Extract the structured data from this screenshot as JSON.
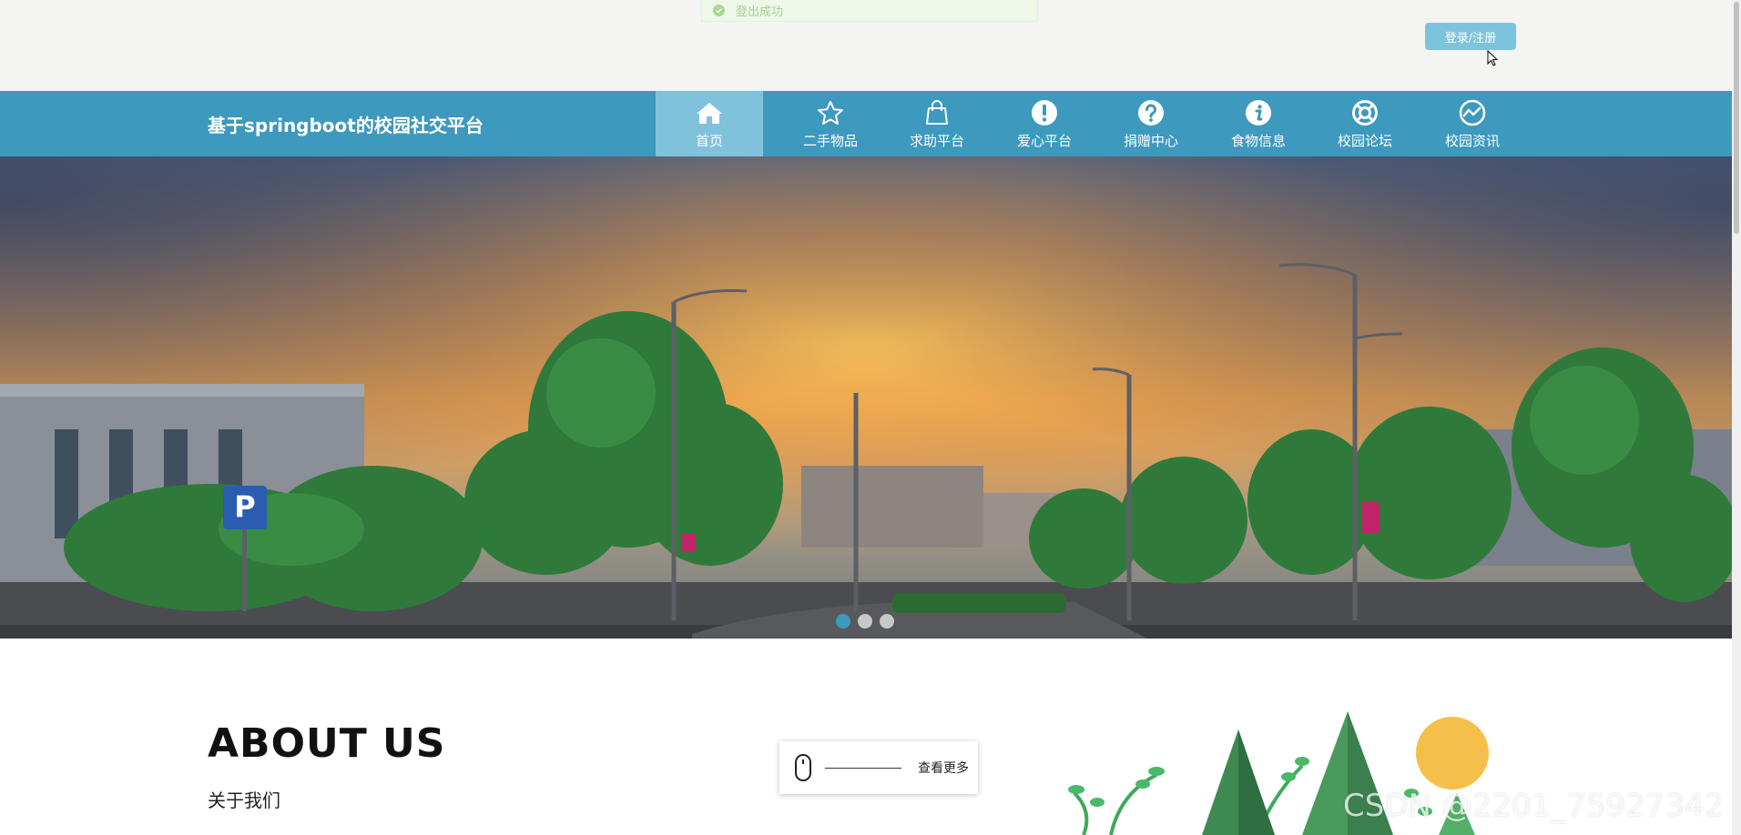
{
  "toast": {
    "message": "登出成功"
  },
  "header": {
    "login_label": "登录/注册"
  },
  "navbar": {
    "brand": "基于springboot的校园社交平台",
    "items": [
      {
        "label": "首页",
        "icon": "home-icon",
        "active": true
      },
      {
        "label": "二手物品",
        "icon": "star-icon",
        "active": false
      },
      {
        "label": "求助平台",
        "icon": "shopping-bag-icon",
        "active": false
      },
      {
        "label": "爱心平台",
        "icon": "exclamation-icon",
        "active": false
      },
      {
        "label": "捐赠中心",
        "icon": "question-icon",
        "active": false
      },
      {
        "label": "食物信息",
        "icon": "info-icon",
        "active": false
      },
      {
        "label": "校园论坛",
        "icon": "lifebuoy-icon",
        "active": false
      },
      {
        "label": "校园资讯",
        "icon": "trend-icon",
        "active": false
      }
    ]
  },
  "carousel": {
    "slide_count": 3,
    "active_index": 0
  },
  "about": {
    "title": "ABOUT US",
    "subtitle": "关于我们",
    "more_label": "查看更多"
  },
  "watermark": "CSDN @2201_75927342",
  "colors": {
    "nav": "#3d99bd",
    "nav_active": "#80c1dc",
    "login": "#7ec3dd"
  }
}
